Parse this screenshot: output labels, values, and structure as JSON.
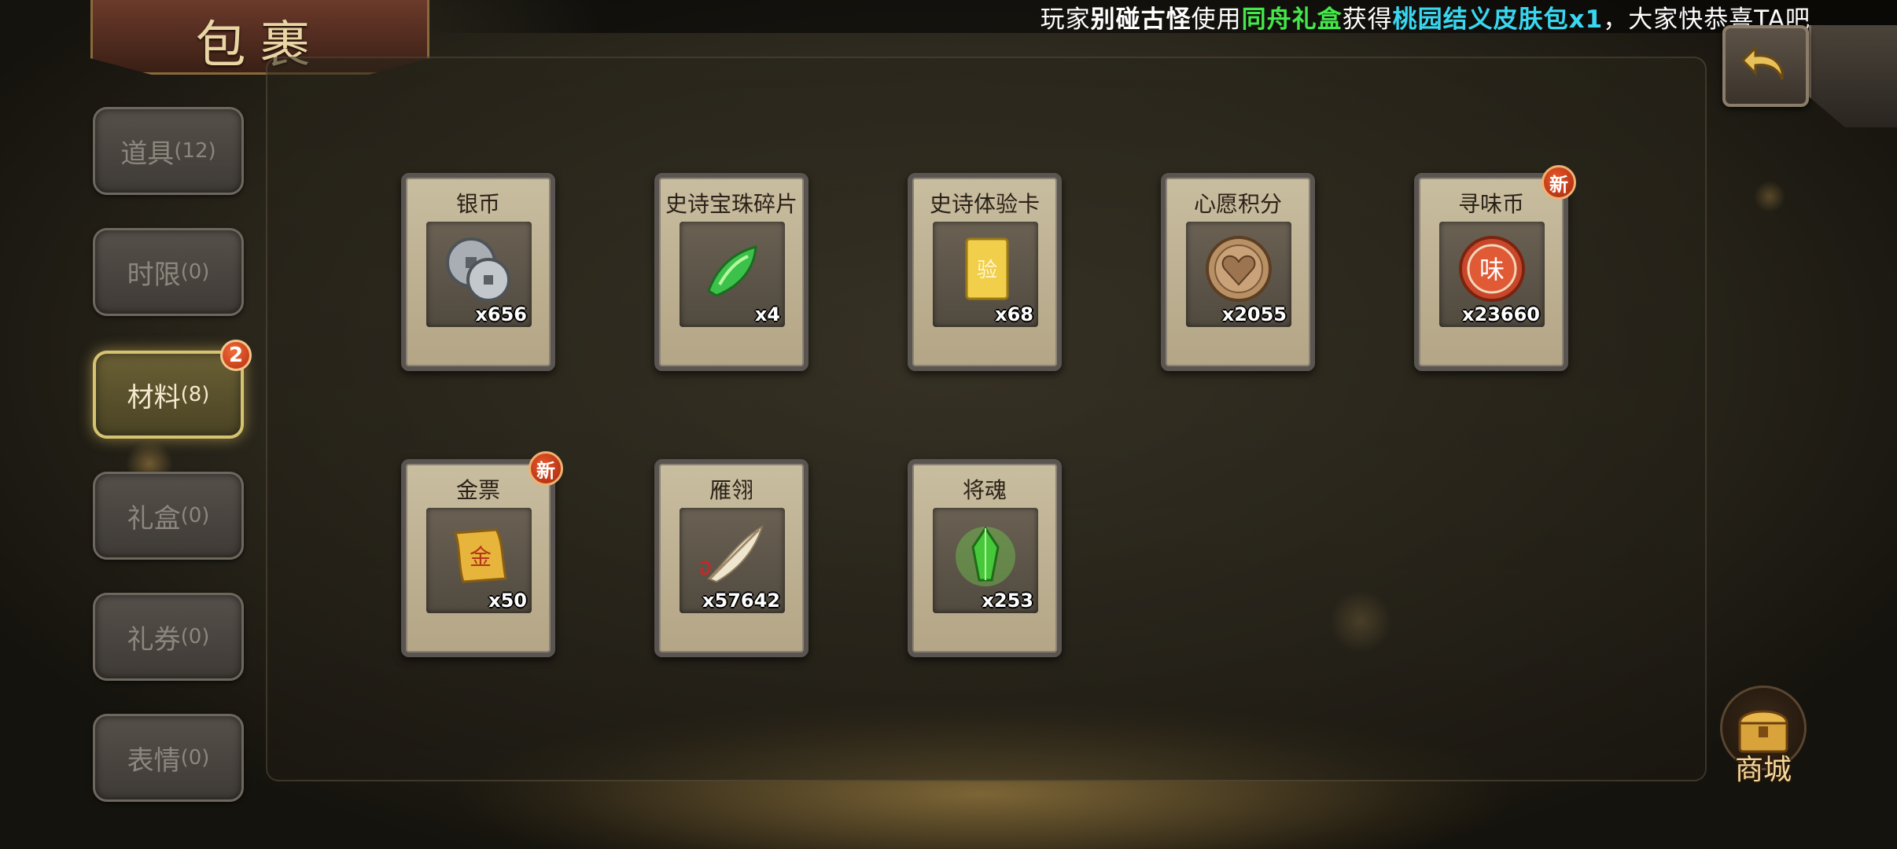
{
  "ticker": {
    "prefix": "玩家",
    "player": "别碰古怪",
    "mid1": "使用",
    "item": "同舟礼盒",
    "mid2": "获得",
    "reward": "桃园结义皮肤包x1",
    "suffix": "，大家快恭喜TA吧"
  },
  "title": "包裹",
  "tabs": [
    {
      "label": "道具",
      "count": "(12)"
    },
    {
      "label": "时限",
      "count": "(0)"
    },
    {
      "label": "材料",
      "count": "(8)",
      "badge": "2"
    },
    {
      "label": "礼盒",
      "count": "(0)"
    },
    {
      "label": "礼券",
      "count": "(0)"
    },
    {
      "label": "表情",
      "count": "(0)"
    }
  ],
  "active_tab": "材料",
  "items": [
    {
      "name": "银币",
      "qty": "x656",
      "icon": "silver-coin-icon"
    },
    {
      "name": "史诗宝珠碎片",
      "qty": "x4",
      "icon": "green-gem-shard-icon"
    },
    {
      "name": "史诗体验卡",
      "qty": "x68",
      "icon": "gold-card-icon",
      "card_glyph": "验"
    },
    {
      "name": "心愿积分",
      "qty": "x2055",
      "icon": "heart-coin-icon"
    },
    {
      "name": "寻味币",
      "qty": "x23660",
      "icon": "flavor-coin-icon",
      "coin_glyph": "味",
      "new": "新"
    },
    {
      "name": "金票",
      "qty": "x50",
      "icon": "gold-ticket-icon",
      "ticket_glyph": "金",
      "new": "新"
    },
    {
      "name": "雁翎",
      "qty": "x57642",
      "icon": "feather-icon"
    },
    {
      "name": "将魂",
      "qty": "x253",
      "icon": "green-crystal-icon"
    }
  ],
  "shop_label": "商城",
  "colors": {
    "ticker_green": "#44e84a",
    "ticker_cyan": "#39d7f0",
    "active_tab_border": "#d6c372",
    "badge_red": "#c33a14"
  }
}
